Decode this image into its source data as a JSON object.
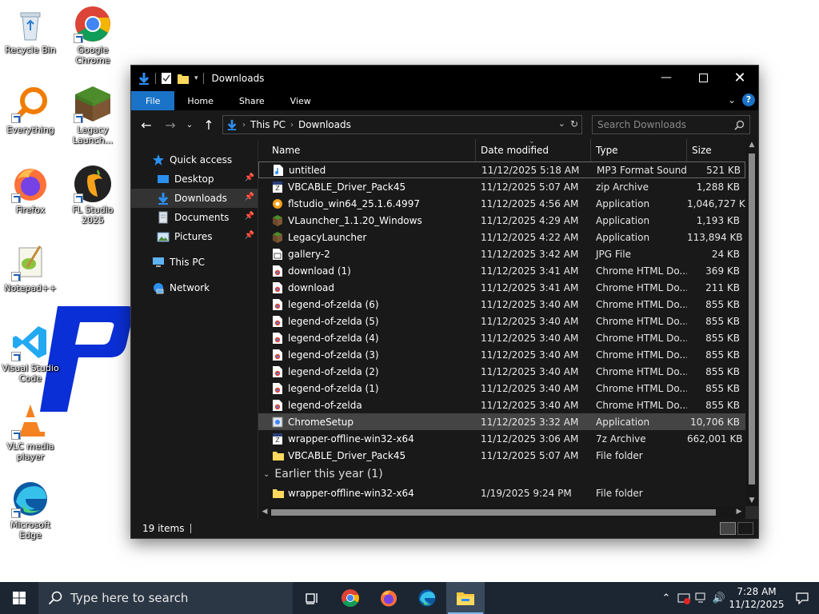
{
  "desktop": {
    "icons": [
      {
        "label": "Recycle Bin"
      },
      {
        "label": "Google Chrome"
      },
      {
        "label": "Everything"
      },
      {
        "label": "Legacy Launch..."
      },
      {
        "label": "Firefox"
      },
      {
        "label": "FL Studio 2025"
      },
      {
        "label": "Notepad++"
      },
      {
        "label": "Visual Studio Code"
      },
      {
        "label": "VLC media player"
      },
      {
        "label": "Microsoft Edge"
      }
    ]
  },
  "window": {
    "title": "Downloads",
    "ribbon_tabs": {
      "file": "File",
      "home": "Home",
      "share": "Share",
      "view": "View"
    },
    "help": "?",
    "address": {
      "root": "This PC",
      "current": "Downloads"
    },
    "search_placeholder": "Search Downloads",
    "nav": {
      "quick_access": "Quick access",
      "desktop": "Desktop",
      "downloads": "Downloads",
      "documents": "Documents",
      "pictures": "Pictures",
      "this_pc": "This PC",
      "network": "Network"
    },
    "columns": {
      "name": "Name",
      "date": "Date modified",
      "type": "Type",
      "size": "Size"
    },
    "files": [
      {
        "name": "untitled",
        "date": "11/12/2025 5:18 AM",
        "type": "MP3 Format Sound",
        "size": "521 KB",
        "icon": "mp3"
      },
      {
        "name": "VBCABLE_Driver_Pack45",
        "date": "11/12/2025 5:07 AM",
        "type": "zip Archive",
        "size": "1,288 KB",
        "icon": "zip"
      },
      {
        "name": "flstudio_win64_25.1.6.4997",
        "date": "11/12/2025 4:56 AM",
        "type": "Application",
        "size": "1,046,727 KB",
        "icon": "flstudio"
      },
      {
        "name": "VLauncher_1.1.20_Windows",
        "date": "11/12/2025 4:29 AM",
        "type": "Application",
        "size": "1,193 KB",
        "icon": "minecraft"
      },
      {
        "name": "LegacyLauncher",
        "date": "11/12/2025 4:22 AM",
        "type": "Application",
        "size": "113,894 KB",
        "icon": "minecraft"
      },
      {
        "name": "gallery-2",
        "date": "11/12/2025 3:42 AM",
        "type": "JPG File",
        "size": "24 KB",
        "icon": "jpg"
      },
      {
        "name": "download (1)",
        "date": "11/12/2025 3:41 AM",
        "type": "Chrome HTML Do...",
        "size": "369 KB",
        "icon": "chrome-html"
      },
      {
        "name": "download",
        "date": "11/12/2025 3:41 AM",
        "type": "Chrome HTML Do...",
        "size": "211 KB",
        "icon": "chrome-html"
      },
      {
        "name": "legend-of-zelda (6)",
        "date": "11/12/2025 3:40 AM",
        "type": "Chrome HTML Do...",
        "size": "855 KB",
        "icon": "chrome-html"
      },
      {
        "name": "legend-of-zelda (5)",
        "date": "11/12/2025 3:40 AM",
        "type": "Chrome HTML Do...",
        "size": "855 KB",
        "icon": "chrome-html"
      },
      {
        "name": "legend-of-zelda (4)",
        "date": "11/12/2025 3:40 AM",
        "type": "Chrome HTML Do...",
        "size": "855 KB",
        "icon": "chrome-html"
      },
      {
        "name": "legend-of-zelda (3)",
        "date": "11/12/2025 3:40 AM",
        "type": "Chrome HTML Do...",
        "size": "855 KB",
        "icon": "chrome-html"
      },
      {
        "name": "legend-of-zelda (2)",
        "date": "11/12/2025 3:40 AM",
        "type": "Chrome HTML Do...",
        "size": "855 KB",
        "icon": "chrome-html"
      },
      {
        "name": "legend-of-zelda (1)",
        "date": "11/12/2025 3:40 AM",
        "type": "Chrome HTML Do...",
        "size": "855 KB",
        "icon": "chrome-html"
      },
      {
        "name": "legend-of-zelda",
        "date": "11/12/2025 3:40 AM",
        "type": "Chrome HTML Do...",
        "size": "855 KB",
        "icon": "chrome-html"
      },
      {
        "name": "ChromeSetup",
        "date": "11/12/2025 3:32 AM",
        "type": "Application",
        "size": "10,706 KB",
        "icon": "setup"
      },
      {
        "name": "wrapper-offline-win32-x64",
        "date": "11/12/2025 3:06 AM",
        "type": "7z Archive",
        "size": "662,001 KB",
        "icon": "zip"
      },
      {
        "name": "VBCABLE_Driver_Pack45",
        "date": "11/12/2025 5:07 AM",
        "type": "File folder",
        "size": "",
        "icon": "folder"
      }
    ],
    "group_earlier": "Earlier this year (1)",
    "earlier_files": [
      {
        "name": "wrapper-offline-win32-x64",
        "date": "1/19/2025 9:24 PM",
        "type": "File folder",
        "size": "",
        "icon": "folder"
      }
    ],
    "status": "19 items"
  },
  "taskbar": {
    "search_placeholder": "Type here to search",
    "time": "7:28 AM",
    "date": "11/12/2025"
  },
  "colors": {
    "accent": "#1a73c7",
    "window_bg": "#191919",
    "taskbar_bg": "#1b2632",
    "selected_row": "#444444"
  }
}
